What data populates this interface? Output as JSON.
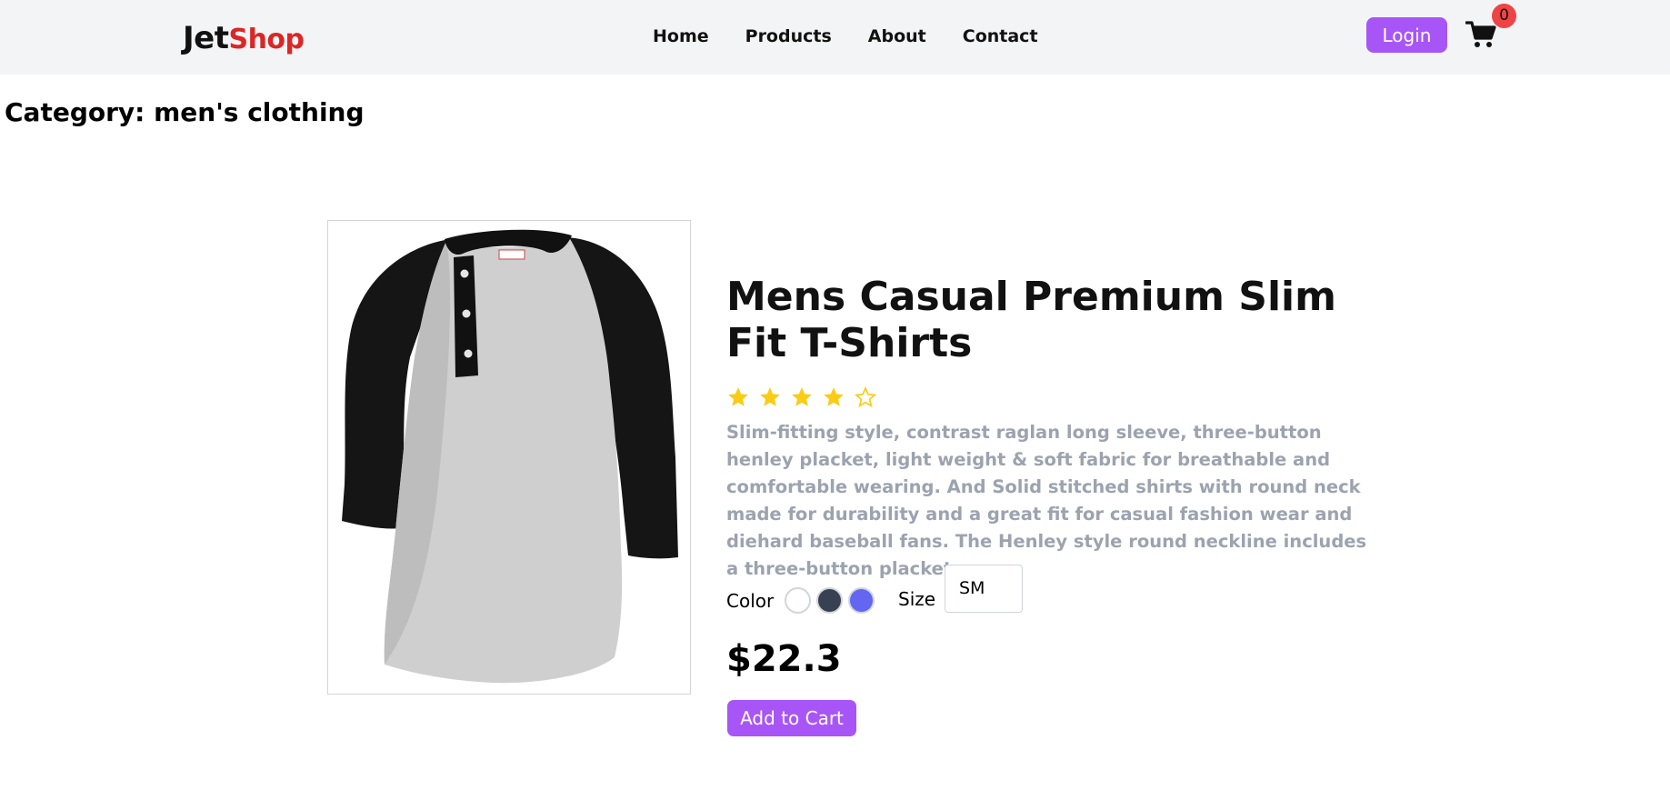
{
  "header": {
    "logo_part1": "Jet",
    "logo_part2": "Shop",
    "nav": [
      "Home",
      "Products",
      "About",
      "Contact"
    ],
    "login_label": "Login",
    "cart_count": "0"
  },
  "category": {
    "label": "Category: men's clothing"
  },
  "product": {
    "title": "Mens Casual Premium Slim Fit T-Shirts",
    "rating": 4,
    "rating_max": 5,
    "description": "Slim-fitting style, contrast raglan long sleeve, three-button henley placket, light weight & soft fabric for breathable and comfortable wearing. And Solid stitched shirts with round neck made for durability and a great fit for casual fashion wear and diehard baseball fans. The Henley style round neckline includes a three-button placket.",
    "color_label": "Color",
    "colors": [
      "#ffffff",
      "#374151",
      "#6366f1"
    ],
    "size_label": "Size",
    "size_value": "SM",
    "price": "$22.3",
    "add_to_cart_label": "Add to Cart"
  },
  "colors": {
    "accent": "#a855f7",
    "brand_red": "#dc2626",
    "badge": "#ef4444",
    "star": "#facc15",
    "header_bg": "#f3f4f6",
    "description_text": "#9ca3af"
  }
}
